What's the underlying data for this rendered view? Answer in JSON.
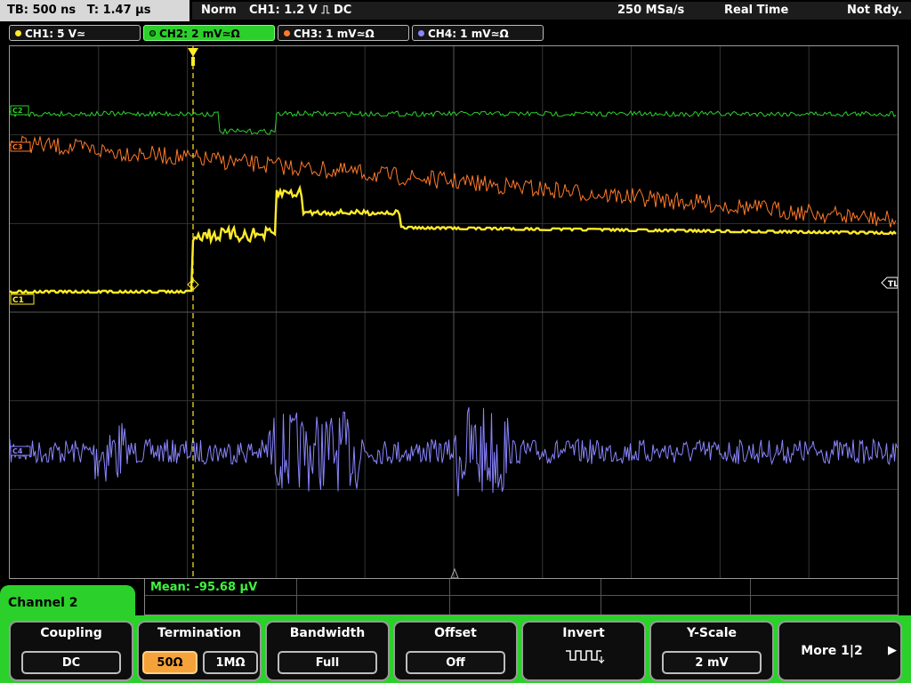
{
  "status": {
    "timebase": "TB: 500 ns",
    "trigger_time": "T: 1.47 µs",
    "mode": "Norm",
    "trigger": "CH1: 1.2 V ⎍ DC",
    "sample_rate": "250 MSa/s",
    "acquisition": "Real Time",
    "state": "Not Rdy."
  },
  "channels": [
    {
      "label": "CH1: 5 V≃",
      "color": "#ffeb2a"
    },
    {
      "label": "CH2: 2 mV≃Ω",
      "color": "#2bd02b"
    },
    {
      "label": "CH3: 1 mV≃Ω",
      "color": "#ff7a2a"
    },
    {
      "label": "CH4: 1 mV≃Ω",
      "color": "#8a85ff"
    }
  ],
  "markers": {
    "trigger_level": "TL",
    "ch1": "C1",
    "ch2": "C2",
    "ch3": "C3",
    "ch4": "C4"
  },
  "measurement": "Mean: -95.68 µV",
  "menu": {
    "title": "Channel 2",
    "coupling": {
      "title": "Coupling",
      "value": "DC"
    },
    "termination": {
      "title": "Termination",
      "opt1": "50Ω",
      "opt2": "1MΩ"
    },
    "bandwidth": {
      "title": "Bandwidth",
      "value": "Full"
    },
    "offset": {
      "title": "Offset",
      "value": "Off"
    },
    "invert": {
      "title": "Invert"
    },
    "yscale": {
      "title": "Y-Scale",
      "value": "2 mV"
    },
    "more": {
      "title": "More 1|2"
    }
  }
}
